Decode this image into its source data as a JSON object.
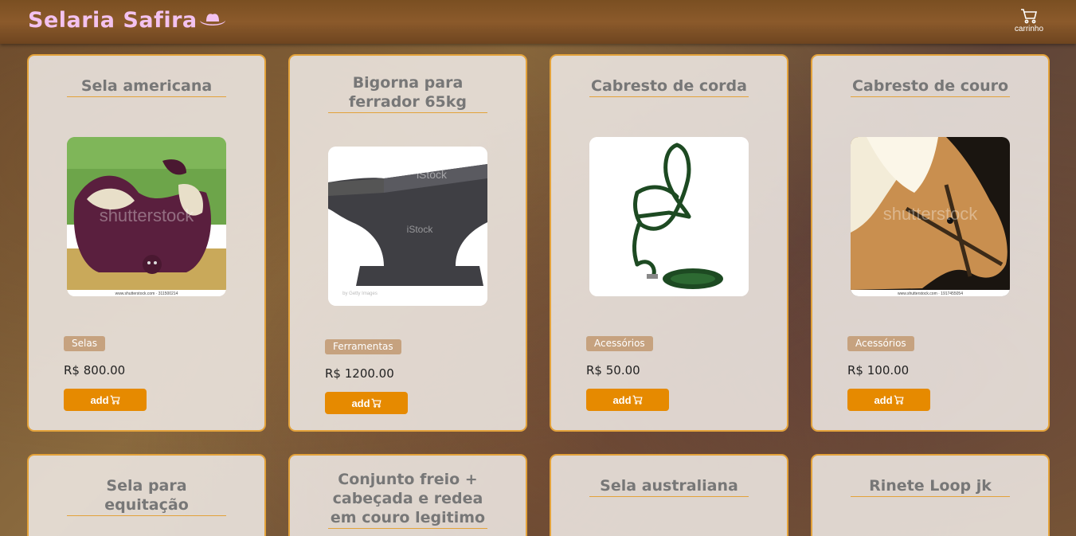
{
  "header": {
    "brand": "Selaria Safira",
    "brand_icon": "cowboy-hat-icon",
    "brand_color": "#f3c2ef",
    "cart_icon": "cart-icon",
    "cart_label": "carrinho"
  },
  "accent": "#e68a00",
  "products": [
    {
      "title": "Sela americana",
      "category": "Selas",
      "price": "R$ 800.00",
      "add_label": "add",
      "image": "saddle-photo"
    },
    {
      "title": "Bigorna para ferrador 65kg",
      "category": "Ferramentas",
      "price": "R$ 1200.00",
      "add_label": "add",
      "image": "anvil-photo"
    },
    {
      "title": "Cabresto de corda",
      "category": "Acessórios",
      "price": "R$ 50.00",
      "add_label": "add",
      "image": "rope-halter-photo"
    },
    {
      "title": "Cabresto de couro",
      "category": "Acessórios",
      "price": "R$ 100.00",
      "add_label": "add",
      "image": "horse-halter-photo"
    },
    {
      "title": "Sela para equitação"
    },
    {
      "title": "Conjunto freio + cabeçada e redea em couro legitimo"
    },
    {
      "title": "Sela australiana"
    },
    {
      "title": "Rinete Loop jk"
    }
  ],
  "watermarks": {
    "shutterstock": "shutterstock",
    "shutterstock_url_1": "www.shutterstock.com · 311500214",
    "shutterstock_url_2": "www.shutterstock.com · 1917455054",
    "istock": "iStock",
    "istock_credit": "by Getty Images"
  }
}
